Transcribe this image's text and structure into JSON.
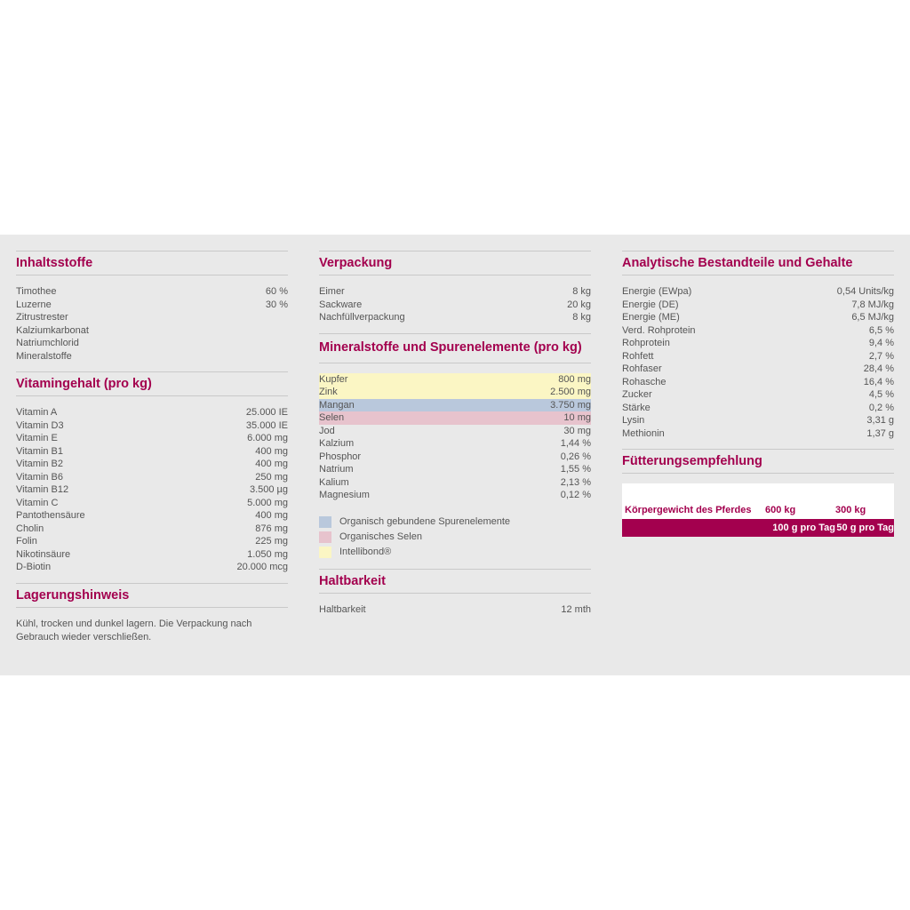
{
  "inhaltsstoffe": {
    "title": "Inhaltsstoffe",
    "rows": [
      {
        "label": "Timothee",
        "value": "60 %"
      },
      {
        "label": "Luzerne",
        "value": "30 %"
      },
      {
        "label": "Zitrustrester",
        "value": ""
      },
      {
        "label": "Kalziumkarbonat",
        "value": ""
      },
      {
        "label": "Natriumchlorid",
        "value": ""
      },
      {
        "label": "Mineralstoffe",
        "value": ""
      }
    ]
  },
  "vitamine": {
    "title": "Vitamingehalt (pro kg)",
    "rows": [
      {
        "label": "Vitamin A",
        "value": "25.000 IE"
      },
      {
        "label": "Vitamin D3",
        "value": "35.000 IE"
      },
      {
        "label": "Vitamin E",
        "value": "6.000 mg"
      },
      {
        "label": "Vitamin B1",
        "value": "400 mg"
      },
      {
        "label": "Vitamin B2",
        "value": "400 mg"
      },
      {
        "label": "Vitamin B6",
        "value": "250 mg"
      },
      {
        "label": "Vitamin B12",
        "value": "3.500 µg"
      },
      {
        "label": "Vitamin C",
        "value": "5.000 mg"
      },
      {
        "label": "Pantothensäure",
        "value": "400 mg"
      },
      {
        "label": "Cholin",
        "value": "876 mg"
      },
      {
        "label": "Folin",
        "value": "225 mg"
      },
      {
        "label": "Nikotinsäure",
        "value": "1.050 mg"
      },
      {
        "label": "D-Biotin",
        "value": "20.000 mcg"
      }
    ]
  },
  "lagerung": {
    "title": "Lagerungshinweis",
    "text": "Kühl, trocken und dunkel lagern. Die Verpackung nach Gebrauch wieder verschließen."
  },
  "verpackung": {
    "title": "Verpackung",
    "rows": [
      {
        "label": "Eimer",
        "value": "8 kg"
      },
      {
        "label": "Sackware",
        "value": "20 kg"
      },
      {
        "label": "Nachfüllverpackung",
        "value": "8 kg"
      }
    ]
  },
  "mineralstoffe": {
    "title": "Mineralstoffe und Spurenelemente (pro kg)",
    "rows": [
      {
        "label": "Kupfer",
        "value": "800 mg",
        "highlight": "yellow"
      },
      {
        "label": "Zink",
        "value": "2.500 mg",
        "highlight": "yellow"
      },
      {
        "label": "Mangan",
        "value": "3.750 mg",
        "highlight": "blue"
      },
      {
        "label": "Selen",
        "value": "10 mg",
        "highlight": "pink"
      },
      {
        "label": "Jod",
        "value": "30 mg"
      },
      {
        "label": "Kalzium",
        "value": "1,44 %"
      },
      {
        "label": "Phosphor",
        "value": "0,26 %"
      },
      {
        "label": "Natrium",
        "value": "1,55 %"
      },
      {
        "label": "Kalium",
        "value": "2,13 %"
      },
      {
        "label": "Magnesium",
        "value": "0,12 %"
      }
    ],
    "legend": [
      {
        "label": "Organisch gebundene Spurenelemente",
        "color": "#b9c8dc"
      },
      {
        "label": "Organisches Selen",
        "color": "#e7c3cd"
      },
      {
        "label": "Intellibond®",
        "color": "#fbf6c4"
      }
    ]
  },
  "haltbarkeit": {
    "title": "Haltbarkeit",
    "rows": [
      {
        "label": "Haltbarkeit",
        "value": "12 mth"
      }
    ]
  },
  "analytisch": {
    "title": "Analytische Bestandteile und Gehalte",
    "rows": [
      {
        "label": "Energie (EWpa)",
        "value": "0,54 Units/kg"
      },
      {
        "label": "Energie (DE)",
        "value": "7,8 MJ/kg"
      },
      {
        "label": "Energie (ME)",
        "value": "6,5 MJ/kg"
      },
      {
        "label": "Verd. Rohprotein",
        "value": "6,5 %"
      },
      {
        "label": "Rohprotein",
        "value": "9,4 %"
      },
      {
        "label": "Rohfett",
        "value": "2,7 %"
      },
      {
        "label": "Rohfaser",
        "value": "28,4 %"
      },
      {
        "label": "Rohasche",
        "value": "16,4 %"
      },
      {
        "label": "Zucker",
        "value": "4,5 %"
      },
      {
        "label": "Stärke",
        "value": "0,2 %"
      },
      {
        "label": "Lysin",
        "value": "3,31 g"
      },
      {
        "label": "Methionin",
        "value": "1,37 g"
      }
    ]
  },
  "fuetterung": {
    "title": "Fütterungsempfehlung",
    "header": [
      "Körpergewicht des Pferdes",
      "600 kg",
      "300 kg"
    ],
    "row": [
      "",
      "100 g pro Tag",
      "50 g pro Tag"
    ]
  },
  "colors": {
    "accent": "#a3004e",
    "panel": "#e9e9e9",
    "intellibond": "#fbf6c4",
    "organic": "#b9c8dc",
    "selen": "#e7c3cd"
  }
}
